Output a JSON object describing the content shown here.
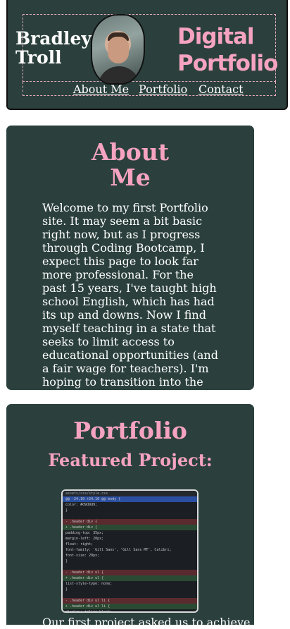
{
  "header": {
    "name_line1": "Bradley",
    "name_line2": "Troll",
    "brand_line1": "Digital",
    "brand_line2": "Portfolio",
    "nav": [
      "About Me",
      "Portfolio",
      "Contact"
    ]
  },
  "about": {
    "title_line1": "About",
    "title_line2": "Me",
    "text": "Welcome to my first Portfolio site. It may seem a bit basic right now, but as I progress through Coding Bootcamp, I expect this page to look far more professional. For the past 15 years, I've taught high school English, which has had its up and downs. Now I find myself teaching in a state that seeks to limit access to educational opportunities (and a fair wage for teachers). I'm hoping to transition into the world of coding and web design over the next year."
  },
  "portfolio": {
    "title": "Portfolio",
    "featured": "Featured Project:",
    "screenshot_lines": [
      "assets/css/style.css",
      "@@ -24,10 +24,10 @@ body {",
      "   color: #d9d9d9;",
      " }",
      "",
      "- .header div {",
      "+ .header div {",
      "   padding-top: 35px;",
      "   margin-left: 20px;",
      "   float: right;",
      "   font-family: 'Gill Sans', 'Gill Sans MT', Calibri;",
      "   font-size: 20px;",
      " }",
      "",
      "- .header div ul {",
      "+ .header div ul {",
      "   list-style-type: none;",
      " }",
      "",
      "- .header div ul li {",
      "+ .header div ul li {",
      "   display: inline-block;"
    ],
    "teaser": "Our first project asked us to achieve"
  },
  "colors": {
    "card_bg": "#2b403d",
    "accent_pink": "#f5a3c0"
  }
}
